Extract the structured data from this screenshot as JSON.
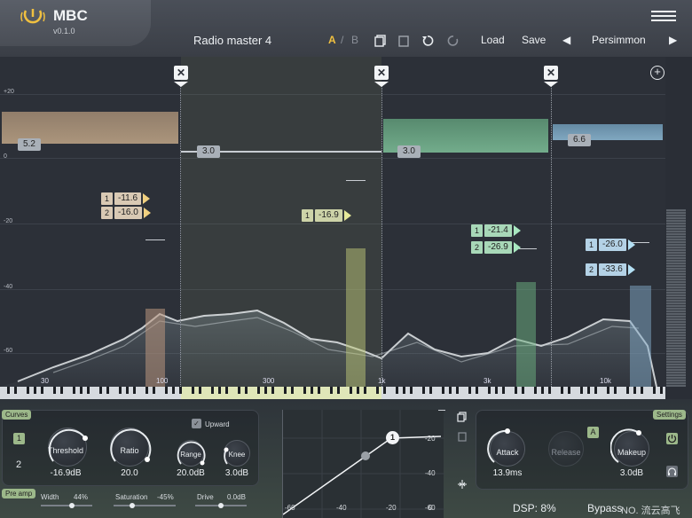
{
  "header": {
    "app_name": "MBC",
    "version": "v0.1.0",
    "preset_name": "Radio master 4",
    "ab_a": "A",
    "ab_sep": "/",
    "ab_b": "B",
    "load_label": "Load",
    "save_label": "Save",
    "preset_browser": "Persimmon"
  },
  "plot": {
    "db_labels": [
      "+20",
      "0",
      "-20",
      "-40",
      "-60"
    ],
    "freq_labels": [
      "30",
      "100",
      "300",
      "1k",
      "3k",
      "10k"
    ],
    "bands": [
      {
        "ratio": "5.2",
        "thresholds": [
          {
            "num": "1",
            "value": "-11.6"
          },
          {
            "num": "2",
            "value": "-16.0"
          }
        ],
        "color": "#b9a083"
      },
      {
        "ratio": "3.0",
        "thresholds": [
          {
            "num": "1",
            "value": "-16.9"
          }
        ],
        "color": "#c8cc8a"
      },
      {
        "ratio": "3.0",
        "thresholds": [
          {
            "num": "1",
            "value": "-21.4"
          },
          {
            "num": "2",
            "value": "-26.9"
          }
        ],
        "color": "#7fc29a"
      },
      {
        "ratio": "6.6",
        "thresholds": [
          {
            "num": "1",
            "value": "-26.0"
          },
          {
            "num": "2",
            "value": "-33.6"
          }
        ],
        "color": "#8fbcd8"
      }
    ],
    "accent_color": "#c8e0a0"
  },
  "curves": {
    "tag": "Curves",
    "curve_1": "1",
    "curve_2": "2",
    "upward_label": "Upward",
    "threshold_label": "Threshold",
    "threshold_value": "-16.9dB",
    "ratio_label": "Ratio",
    "ratio_value": "20.0",
    "range_label": "Range",
    "range_value": "20.0dB",
    "knee_label": "Knee",
    "knee_value": "3.0dB"
  },
  "preamp": {
    "tag": "Pre amp",
    "width_label": "Width",
    "width_value": "44%",
    "saturation_label": "Saturation",
    "saturation_value": "-45%",
    "drive_label": "Drive",
    "drive_value": "0.0dB"
  },
  "transfer": {
    "y_labels": [
      "-20",
      "-40",
      "-60"
    ],
    "x_labels": [
      "-60",
      "-40",
      "-20",
      "0"
    ],
    "node": "1"
  },
  "settings": {
    "tag": "Settings",
    "attack_label": "Attack",
    "attack_value": "13.9ms",
    "release_label": "Release",
    "auto_label": "A",
    "makeup_label": "Makeup",
    "makeup_value": "3.0dB"
  },
  "status": {
    "dsp": "DSP: 8%",
    "bypass": "Bypass"
  },
  "watermark": "NO. 流云高飞"
}
